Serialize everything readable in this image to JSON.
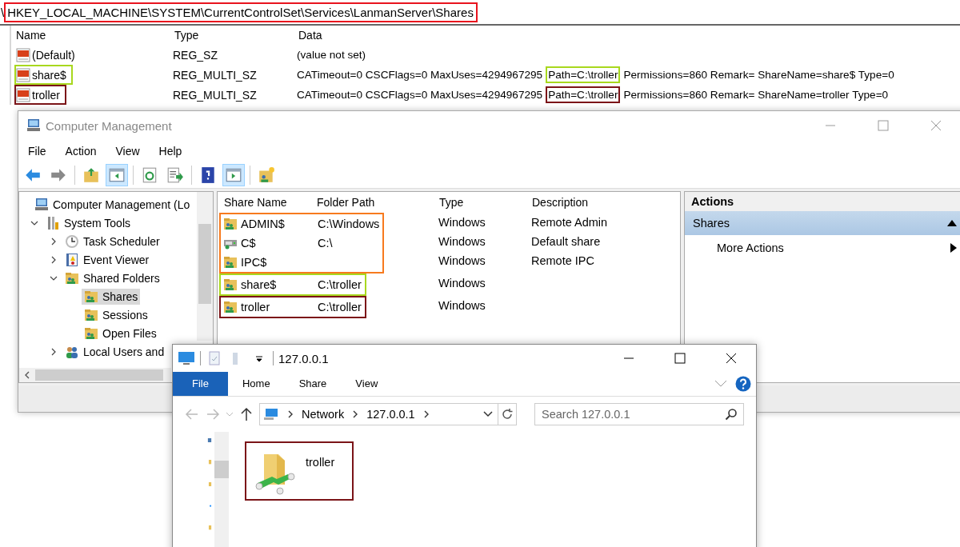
{
  "registry": {
    "address_prefix": "\\",
    "address": "HKEY_LOCAL_MACHINE\\SYSTEM\\CurrentControlSet\\Services\\LanmanServer\\Shares",
    "columns": [
      "Name",
      "Type",
      "Data"
    ],
    "rows": [
      {
        "name": "(Default)",
        "type": "REG_SZ",
        "data": "(value not set)"
      },
      {
        "name": "share$",
        "type": "REG_MULTI_SZ",
        "data": "CATimeout=0 CSCFlags=0 MaxUses=4294967295",
        "path": "Path=C:\\troller",
        "data_end": "Permissions=860 Remark= ShareName=share$ Type=0",
        "color": "#a8d81e"
      },
      {
        "name": "troller",
        "type": "REG_MULTI_SZ",
        "data": "CATimeout=0 CSCFlags=0 MaxUses=4294967295",
        "path": "Path=C:\\troller",
        "data_end": "Permissions=860 Remark= ShareName=troller Type=0",
        "color": "#7b1418"
      }
    ]
  },
  "computer_management": {
    "title": "Computer Management",
    "menu": [
      "File",
      "Action",
      "View",
      "Help"
    ],
    "toolbar": [
      {
        "kind": "back",
        "pressed": false
      },
      {
        "kind": "forward",
        "pressed": false
      },
      {
        "kind": "up",
        "pressed": false
      },
      {
        "kind": "tree-pane",
        "pressed": true
      },
      {
        "kind": "refresh",
        "pressed": false
      },
      {
        "kind": "export",
        "pressed": false
      },
      {
        "kind": "help",
        "pressed": false
      },
      {
        "kind": "action-pane",
        "pressed": true
      },
      {
        "kind": "new-share",
        "pressed": false
      }
    ],
    "tree": [
      {
        "label": "Computer Management (Lo",
        "kind": "computer",
        "selected": false,
        "children": [
          {
            "label": "System Tools",
            "kind": "tools",
            "expanded": true,
            "selected": false,
            "children": [
              {
                "label": "Task Scheduler",
                "kind": "clock",
                "expanded": false,
                "selected": false
              },
              {
                "label": "Event Viewer",
                "kind": "events",
                "expanded": false,
                "selected": false
              },
              {
                "label": "Shared Folders",
                "kind": "share",
                "expanded": true,
                "selected": false,
                "children": [
                  {
                    "label": "Shares",
                    "kind": "share",
                    "selected": true
                  },
                  {
                    "label": "Sessions",
                    "kind": "share",
                    "selected": false
                  },
                  {
                    "label": "Open Files",
                    "kind": "share",
                    "selected": false
                  }
                ]
              },
              {
                "label": "Local Users and",
                "kind": "users",
                "expanded": false,
                "selected": false
              }
            ]
          }
        ]
      }
    ],
    "shares": {
      "columns": [
        "Share Name",
        "Folder Path",
        "Type",
        "Description"
      ],
      "groups": [
        {
          "color": "#f77a1e",
          "rows": [
            {
              "name": "ADMIN$",
              "kind": "share",
              "path": "C:\\Windows",
              "type": "Windows",
              "description": "Remote Admin"
            },
            {
              "name": "C$",
              "kind": "drive",
              "path": "C:\\",
              "type": "Windows",
              "description": "Default share"
            },
            {
              "name": "IPC$",
              "kind": "share",
              "type": "Windows",
              "description": "Remote IPC"
            }
          ]
        },
        {
          "color": "#a8d81e",
          "rows": [
            {
              "name": "share$",
              "kind": "share",
              "path": "C:\\troller",
              "type": "Windows"
            }
          ]
        },
        {
          "color": "#7b1418",
          "rows": [
            {
              "name": "troller",
              "kind": "share",
              "path": "C:\\troller",
              "type": "Windows"
            }
          ]
        }
      ]
    },
    "actions": {
      "title": "Actions",
      "section": "Shares",
      "expanded": true,
      "items": [
        "More Actions"
      ]
    }
  },
  "explorer": {
    "title": "127.0.0.1",
    "tabs": [
      {
        "label": "File",
        "selected": true
      },
      {
        "label": "Home",
        "selected": false
      },
      {
        "label": "Share",
        "selected": false
      },
      {
        "label": "View",
        "selected": false
      }
    ],
    "address": [
      "Network",
      "127.0.0.1"
    ],
    "search": {
      "placeholder": "Search 127.0.0.1"
    },
    "items": [
      {
        "name": "troller",
        "color": "#7b1418"
      }
    ]
  }
}
